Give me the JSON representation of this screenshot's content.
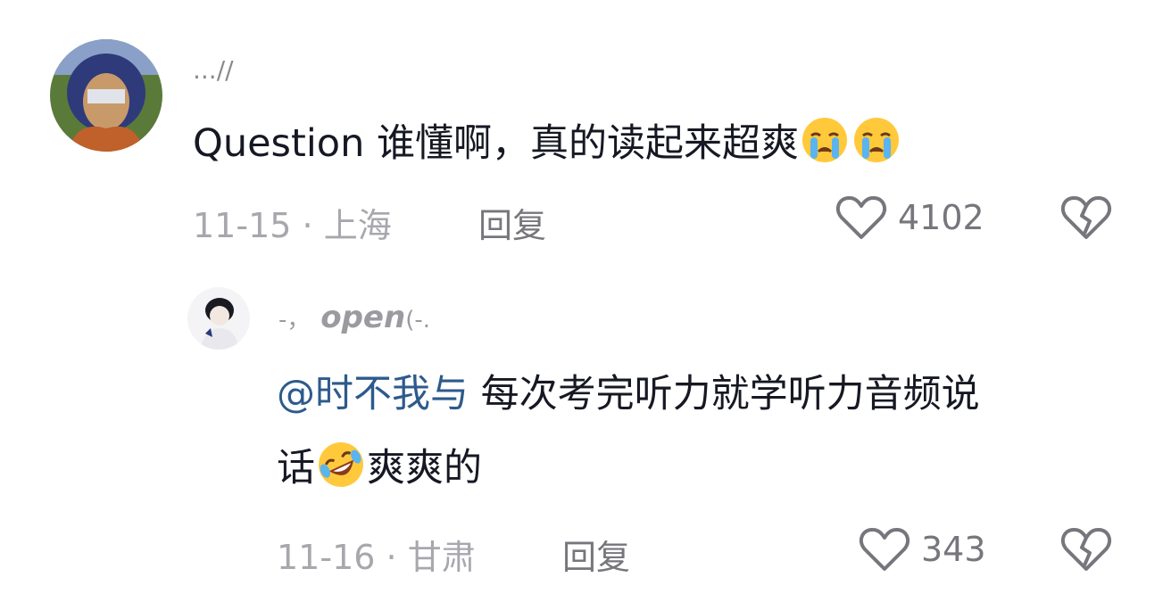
{
  "comments": [
    {
      "username": "...//",
      "text_before": "Question 谁懂啊，真的读起来超爽",
      "emojis": [
        "crying-face",
        "crying-face"
      ],
      "date": "11-15",
      "location": "上海",
      "reply_label": "回复",
      "likes": "4102"
    },
    {
      "username": "open",
      "username_prefix": "-，",
      "username_suffix": "(-.",
      "mention": "@时不我与",
      "text_line1": " 每次考完听力就学听力音频说",
      "text_line2_a": "话",
      "text_line2_b": "爽爽的",
      "emojis": [
        "rolling-laughing-face"
      ],
      "date": "11-16",
      "location": "甘肃",
      "reply_label": "回复",
      "likes": "343"
    }
  ],
  "meta_separator": "·",
  "colors": {
    "mention": "#2d5a8c",
    "meta": "#a7a7ad",
    "icon": "#76767c"
  }
}
